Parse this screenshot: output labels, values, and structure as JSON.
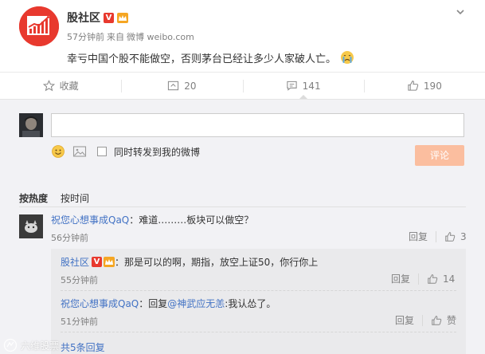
{
  "post": {
    "author": "股社区",
    "verified_badge": "V",
    "time": "57分钟前",
    "source_prefix": "来自",
    "source_name": "微博 weibo.com",
    "text": "幸亏中国个股不能做空，否则茅台已经让多少人家破人亡。",
    "emoji": "crying-face-icon",
    "menu_icon": "chevron-down-icon"
  },
  "actions": {
    "favorite_label": "收藏",
    "repost_count": "20",
    "comment_count": "141",
    "like_count": "190"
  },
  "composer": {
    "input_value": "",
    "repost_label": "同时转发到我的微博",
    "submit_label": "评论"
  },
  "sort": {
    "by_heat": "按热度",
    "by_time": "按时间"
  },
  "comments": [
    {
      "user": "祝您心想事成QaQ",
      "separator": "：",
      "text": "难道………板块可以做空？",
      "time": "56分钟前",
      "reply_label": "回复",
      "likes": "3"
    }
  ],
  "replies": [
    {
      "user": "股社区",
      "separator": "：",
      "text": "那是可以的啊，期指，放空上证50，你行你上",
      "time": "55分钟前",
      "reply_label": "回复",
      "likes": "14"
    },
    {
      "user": "祝您心想事成QaQ",
      "separator": "：",
      "reply_prefix": "回复",
      "mention": "@神武应无恙",
      "text": ":我认怂了。",
      "time": "51分钟前",
      "reply_label": "回复",
      "likes": "赞"
    }
  ],
  "more_replies": "共5条回复",
  "watermark": "六维股票",
  "colors": {
    "brand_red": "#e8392e",
    "link_blue": "#4272c4",
    "submit_disabled": "#fbbe9f",
    "panel_bg": "#f2f2f5"
  }
}
